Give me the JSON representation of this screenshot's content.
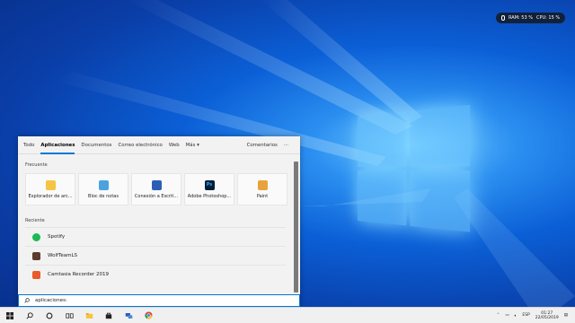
{
  "perf": {
    "ram": "RAM: 53 %",
    "cpu": "CPU: 15 %"
  },
  "search_panel": {
    "tabs": [
      "Todo",
      "Aplicaciones",
      "Documentos",
      "Correo electrónico",
      "Web",
      "Más ▾"
    ],
    "feedback": "Comentarios",
    "more": "···",
    "frequent_label": "Frecuente",
    "frequent": [
      {
        "label": "Explorador de arc...",
        "icon": "folder-icon",
        "color": "#f5c542"
      },
      {
        "label": "Bloc de notas",
        "icon": "notepad-icon",
        "color": "#4aa3df"
      },
      {
        "label": "Conexión a Escrit...",
        "icon": "remote-desktop-icon",
        "color": "#2b5fb4"
      },
      {
        "label": "Adobe Photoshop...",
        "icon": "photoshop-icon",
        "color": "#001e36",
        "glyph": "Ps"
      },
      {
        "label": "Paint",
        "icon": "paint-icon",
        "color": "#e9a23b"
      }
    ],
    "recent_label": "Reciente",
    "recent": [
      {
        "label": "Spotify",
        "icon": "spotify-icon",
        "color": "#1db954"
      },
      {
        "label": "WolfTeamLS",
        "icon": "wolfteam-icon",
        "color": "#5a3b2e"
      },
      {
        "label": "Camtasia Recorder 2019",
        "icon": "camtasia-icon",
        "color": "#e85a2b"
      }
    ],
    "search_value": "aplicaciones:"
  },
  "taskbar": {
    "lang": "ESP",
    "time": "01:27",
    "date": "22/05/2019"
  }
}
